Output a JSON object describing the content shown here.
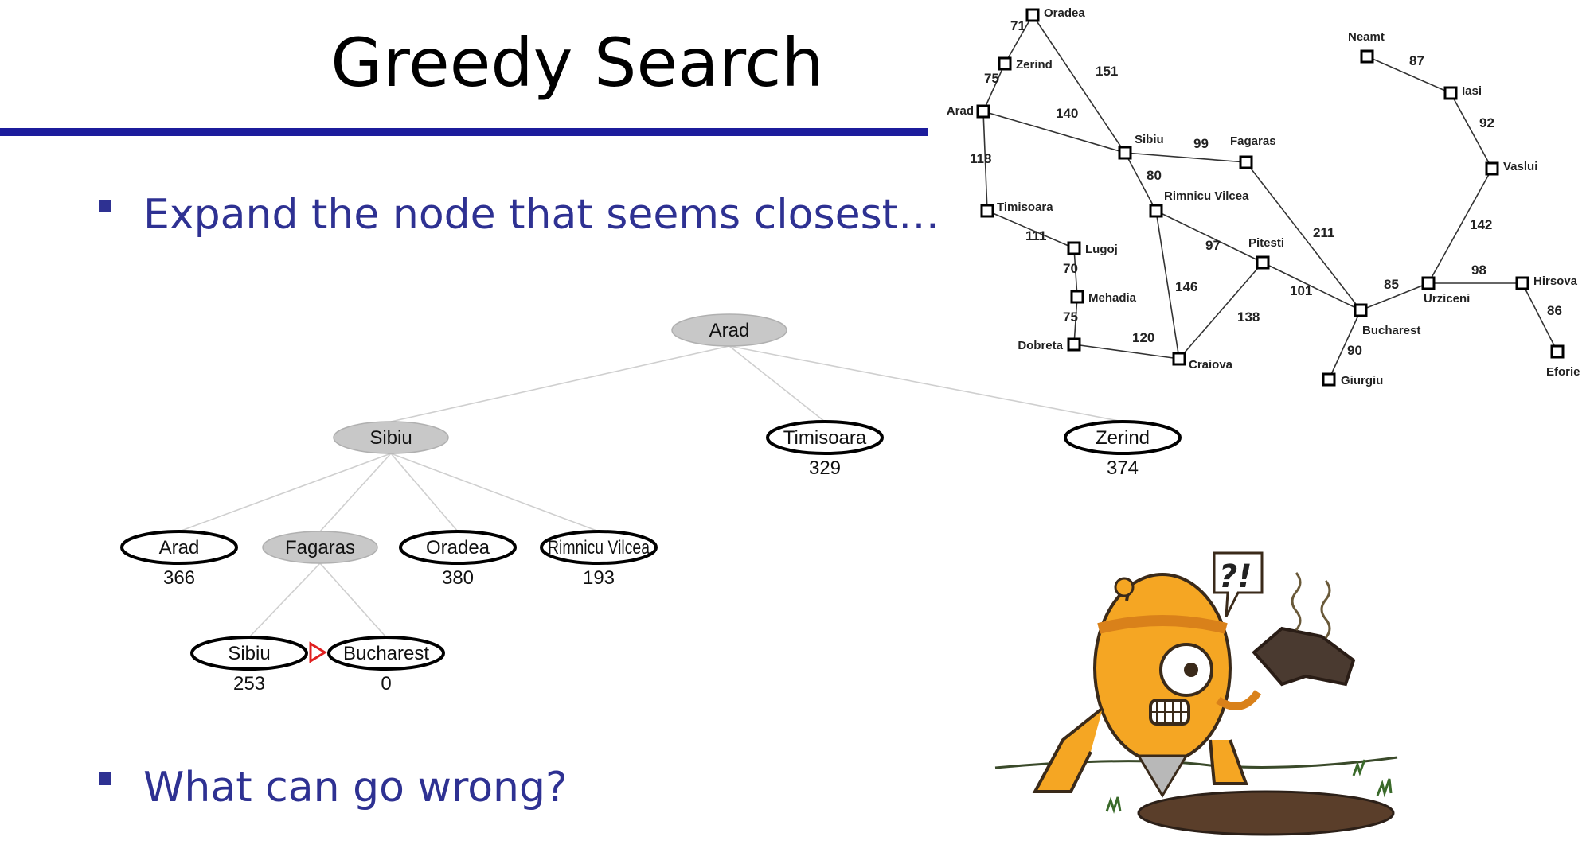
{
  "slide": {
    "title": "Greedy Search",
    "bullets": [
      "Expand the node that seems closest…",
      "What can go wrong?"
    ],
    "colors": {
      "bullet": "#2e3192",
      "rule": "#1c1c9c",
      "expanded_node": "#c8c8c8",
      "loop_marker": "#e02020"
    }
  },
  "search_tree": {
    "nodes": [
      {
        "id": "arad",
        "label": "Arad",
        "h": "",
        "expanded": true
      },
      {
        "id": "sibiu",
        "label": "Sibiu",
        "h": "",
        "expanded": true
      },
      {
        "id": "timisoara",
        "label": "Timisoara",
        "h": "329",
        "expanded": false
      },
      {
        "id": "zerind",
        "label": "Zerind",
        "h": "374",
        "expanded": false
      },
      {
        "id": "arad2",
        "label": "Arad",
        "h": "366",
        "expanded": false
      },
      {
        "id": "fagaras",
        "label": "Fagaras",
        "h": "",
        "expanded": true
      },
      {
        "id": "oradea",
        "label": "Oradea",
        "h": "380",
        "expanded": false
      },
      {
        "id": "rimnicu",
        "label": "Rimnicu Vilcea",
        "h": "193",
        "expanded": false
      },
      {
        "id": "sibiu2",
        "label": "Sibiu",
        "h": "253",
        "expanded": false
      },
      {
        "id": "bucharest",
        "label": "Bucharest",
        "h": "0",
        "expanded": false
      }
    ],
    "edges": [
      [
        "arad",
        "sibiu"
      ],
      [
        "arad",
        "timisoara"
      ],
      [
        "arad",
        "zerind"
      ],
      [
        "sibiu",
        "arad2"
      ],
      [
        "sibiu",
        "fagaras"
      ],
      [
        "sibiu",
        "oradea"
      ],
      [
        "sibiu",
        "rimnicu"
      ],
      [
        "fagaras",
        "sibiu2"
      ],
      [
        "fagaras",
        "bucharest"
      ]
    ]
  },
  "romania_map": {
    "cities": [
      {
        "id": "oradea",
        "name": "Oradea"
      },
      {
        "id": "zerind",
        "name": "Zerind"
      },
      {
        "id": "arad",
        "name": "Arad"
      },
      {
        "id": "timisoara",
        "name": "Timisoara"
      },
      {
        "id": "lugoj",
        "name": "Lugoj"
      },
      {
        "id": "mehadia",
        "name": "Mehadia"
      },
      {
        "id": "dobreta",
        "name": "Dobreta"
      },
      {
        "id": "craiova",
        "name": "Craiova"
      },
      {
        "id": "sibiu",
        "name": "Sibiu"
      },
      {
        "id": "rimnicu",
        "name": "Rimnicu Vilcea"
      },
      {
        "id": "fagaras",
        "name": "Fagaras"
      },
      {
        "id": "pitesti",
        "name": "Pitesti"
      },
      {
        "id": "bucharest",
        "name": "Bucharest"
      },
      {
        "id": "giurgiu",
        "name": "Giurgiu"
      },
      {
        "id": "urziceni",
        "name": "Urziceni"
      },
      {
        "id": "hirsova",
        "name": "Hirsova"
      },
      {
        "id": "eforie",
        "name": "Eforie"
      },
      {
        "id": "vaslui",
        "name": "Vaslui"
      },
      {
        "id": "iasi",
        "name": "Iasi"
      },
      {
        "id": "neamt",
        "name": "Neamt"
      }
    ],
    "roads": [
      {
        "a": "oradea",
        "b": "zerind",
        "d": "71"
      },
      {
        "a": "zerind",
        "b": "arad",
        "d": "75"
      },
      {
        "a": "oradea",
        "b": "sibiu",
        "d": "151"
      },
      {
        "a": "arad",
        "b": "sibiu",
        "d": "140"
      },
      {
        "a": "arad",
        "b": "timisoara",
        "d": "118"
      },
      {
        "a": "timisoara",
        "b": "lugoj",
        "d": "111"
      },
      {
        "a": "lugoj",
        "b": "mehadia",
        "d": "70"
      },
      {
        "a": "mehadia",
        "b": "dobreta",
        "d": "75"
      },
      {
        "a": "dobreta",
        "b": "craiova",
        "d": "120"
      },
      {
        "a": "sibiu",
        "b": "fagaras",
        "d": "99"
      },
      {
        "a": "sibiu",
        "b": "rimnicu",
        "d": "80"
      },
      {
        "a": "rimnicu",
        "b": "pitesti",
        "d": "97"
      },
      {
        "a": "rimnicu",
        "b": "craiova",
        "d": "146"
      },
      {
        "a": "craiova",
        "b": "pitesti",
        "d": "138"
      },
      {
        "a": "fagaras",
        "b": "bucharest",
        "d": "211"
      },
      {
        "a": "pitesti",
        "b": "bucharest",
        "d": "101"
      },
      {
        "a": "bucharest",
        "b": "giurgiu",
        "d": "90"
      },
      {
        "a": "bucharest",
        "b": "urziceni",
        "d": "85"
      },
      {
        "a": "urziceni",
        "b": "hirsova",
        "d": "98"
      },
      {
        "a": "hirsova",
        "b": "eforie",
        "d": "86"
      },
      {
        "a": "urziceni",
        "b": "vaslui",
        "d": "142"
      },
      {
        "a": "vaslui",
        "b": "iasi",
        "d": "92"
      },
      {
        "a": "iasi",
        "b": "neamt",
        "d": "87"
      }
    ]
  },
  "cartoon": {
    "speech_bubble": "?!",
    "description_icon": "robot-holding-old-boot-icon"
  }
}
